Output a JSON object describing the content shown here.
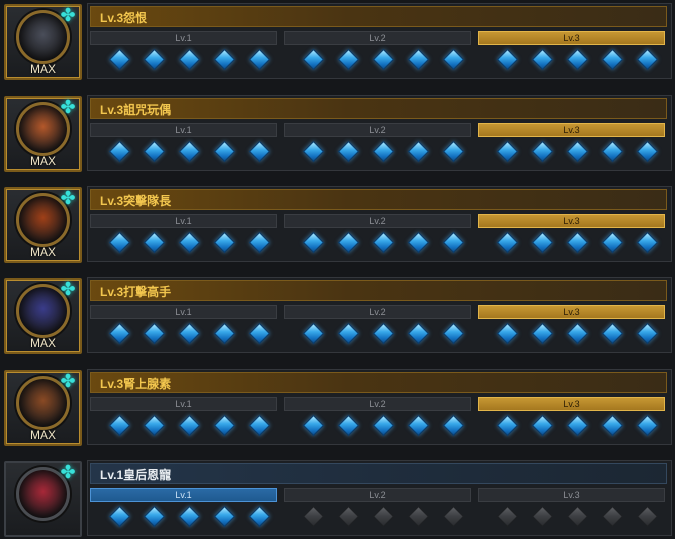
{
  "colors": {
    "gold_accent": "#f2c64e",
    "blue_accent": "#2a6aa5",
    "compass": "#38e0d9",
    "gem_active": "#39a9ea",
    "gem_inactive": "#3d3f43"
  },
  "rows": [
    {
      "title": "Lv.3怨恨",
      "badge": "MAX",
      "icon": "compass-icon",
      "portrait_color": "#4a4e5a",
      "active_level": 3,
      "theme": "gold",
      "levels": [
        {
          "label": "Lv.1",
          "filled": 5
        },
        {
          "label": "Lv.2",
          "filled": 5
        },
        {
          "label": "Lv.3",
          "filled": 5
        }
      ]
    },
    {
      "title": "Lv.3詛咒玩偶",
      "badge": "MAX",
      "icon": "compass-icon",
      "portrait_color": "#b4582a",
      "active_level": 3,
      "theme": "gold",
      "levels": [
        {
          "label": "Lv.1",
          "filled": 5
        },
        {
          "label": "Lv.2",
          "filled": 5
        },
        {
          "label": "Lv.3",
          "filled": 5
        }
      ]
    },
    {
      "title": "Lv.3突擊隊長",
      "badge": "MAX",
      "icon": "compass-icon",
      "portrait_color": "#a04018",
      "active_level": 3,
      "theme": "gold",
      "levels": [
        {
          "label": "Lv.1",
          "filled": 5
        },
        {
          "label": "Lv.2",
          "filled": 5
        },
        {
          "label": "Lv.3",
          "filled": 5
        }
      ]
    },
    {
      "title": "Lv.3打擊高手",
      "badge": "MAX",
      "icon": "compass-icon",
      "portrait_color": "#3a3c8a",
      "active_level": 3,
      "theme": "gold",
      "levels": [
        {
          "label": "Lv.1",
          "filled": 5
        },
        {
          "label": "Lv.2",
          "filled": 5
        },
        {
          "label": "Lv.3",
          "filled": 5
        }
      ]
    },
    {
      "title": "Lv.3腎上腺素",
      "badge": "MAX",
      "icon": "compass-icon",
      "portrait_color": "#8a4a24",
      "active_level": 3,
      "theme": "gold",
      "levels": [
        {
          "label": "Lv.1",
          "filled": 5
        },
        {
          "label": "Lv.2",
          "filled": 5
        },
        {
          "label": "Lv.3",
          "filled": 5
        }
      ]
    },
    {
      "title": "Lv.1皇后恩寵",
      "badge": "",
      "icon": "compass-icon",
      "portrait_color": "#a82838",
      "active_level": 1,
      "theme": "blue",
      "levels": [
        {
          "label": "Lv.1",
          "filled": 5
        },
        {
          "label": "Lv.2",
          "filled": 0
        },
        {
          "label": "Lv.3",
          "filled": 0
        }
      ]
    }
  ]
}
